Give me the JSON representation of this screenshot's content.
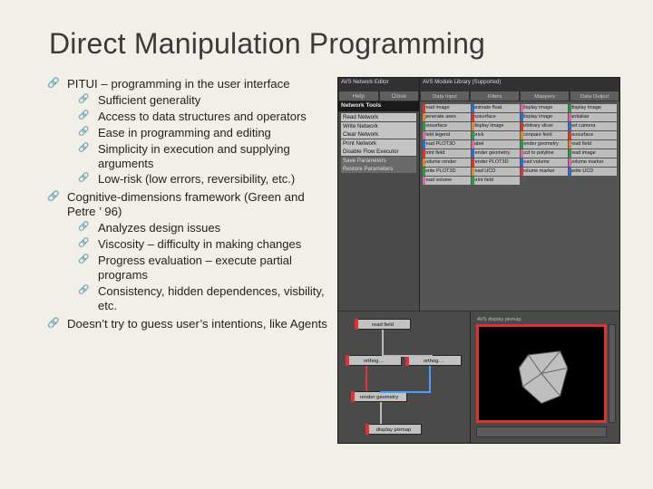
{
  "title": "Direct Manipulation Programming",
  "outline": [
    {
      "text": "PITUI – programming in the user interface",
      "sub": [
        "Sufficient generality",
        "Access to data structures and operators",
        "Ease in programming and editing",
        "Simplicity in execution and supplying arguments",
        "Low-risk (low errors, reversibility, etc.)"
      ]
    },
    {
      "text": "Cognitive-dimensions framework (Green and Petre ’ 96)",
      "sub": [
        "Analyzes design issues",
        "Viscosity – difficulty in making changes",
        "Progress evaluation – execute partial programs",
        "Consistency, hidden dependences, visbility, etc."
      ]
    },
    {
      "text": "Doesn’t try to guess user’s intentions, like Agents",
      "sub": []
    }
  ],
  "figure": {
    "leftWindow": {
      "title": "AVS Network Editor",
      "buttons": [
        "Help",
        "Close"
      ],
      "section": "Network Tools",
      "items": [
        "Read Network",
        "Write Network",
        "Clear Network",
        "Print Network",
        "Disable Flow Executor",
        "Save Parameters",
        "Restore Parameters"
      ]
    },
    "rightWindow": {
      "title": "AVS Module Library (Supported)",
      "tabs": [
        "Data Input",
        "Filters",
        "Mappers",
        "Data Output"
      ],
      "modules": [
        "read image",
        "animate float",
        "display image",
        "display image",
        "generate axes",
        "isosurface",
        "display image",
        "antialias",
        "isosurface",
        "display image",
        "arbitrary slicer",
        "set camera",
        "field legend",
        "brick",
        "compare field",
        "isosurface",
        "read PLOT3D",
        "label",
        "render geometry",
        "read field",
        "print field",
        "render geometry",
        "ucd to polyline",
        "read image",
        "volume render",
        "render PLOT3D",
        "read volume",
        "volume marker",
        "write PLOT3D",
        "read UCD",
        "volume marker",
        "write UCD",
        "read volume",
        "print field"
      ]
    },
    "nodes": [
      "read field",
      "orthog…",
      "orthog…",
      "render geometry",
      "display pixmap"
    ],
    "viewer": {
      "title": "AVS display pixmap"
    }
  }
}
